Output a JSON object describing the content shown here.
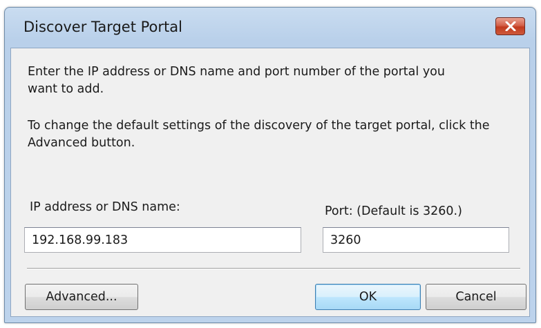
{
  "window": {
    "title": "Discover Target Portal"
  },
  "content": {
    "instruction_1": "Enter the IP address or DNS name and port number of the portal you want to add.",
    "instruction_2": "To change the default settings of the discovery of the target portal, click the Advanced button."
  },
  "fields": {
    "ip_label": "IP address or DNS name:",
    "ip_value": "192.168.99.183",
    "port_label": "Port: (Default is 3260.)",
    "port_value": "3260"
  },
  "buttons": {
    "advanced": "Advanced...",
    "ok": "OK",
    "cancel": "Cancel"
  },
  "icons": {
    "close": "close-icon"
  },
  "colors": {
    "close_button": "#c94a2e",
    "client_background": "#f0f0f0",
    "frame": "#bdd3ec",
    "default_button_border": "#3c7fb1"
  }
}
